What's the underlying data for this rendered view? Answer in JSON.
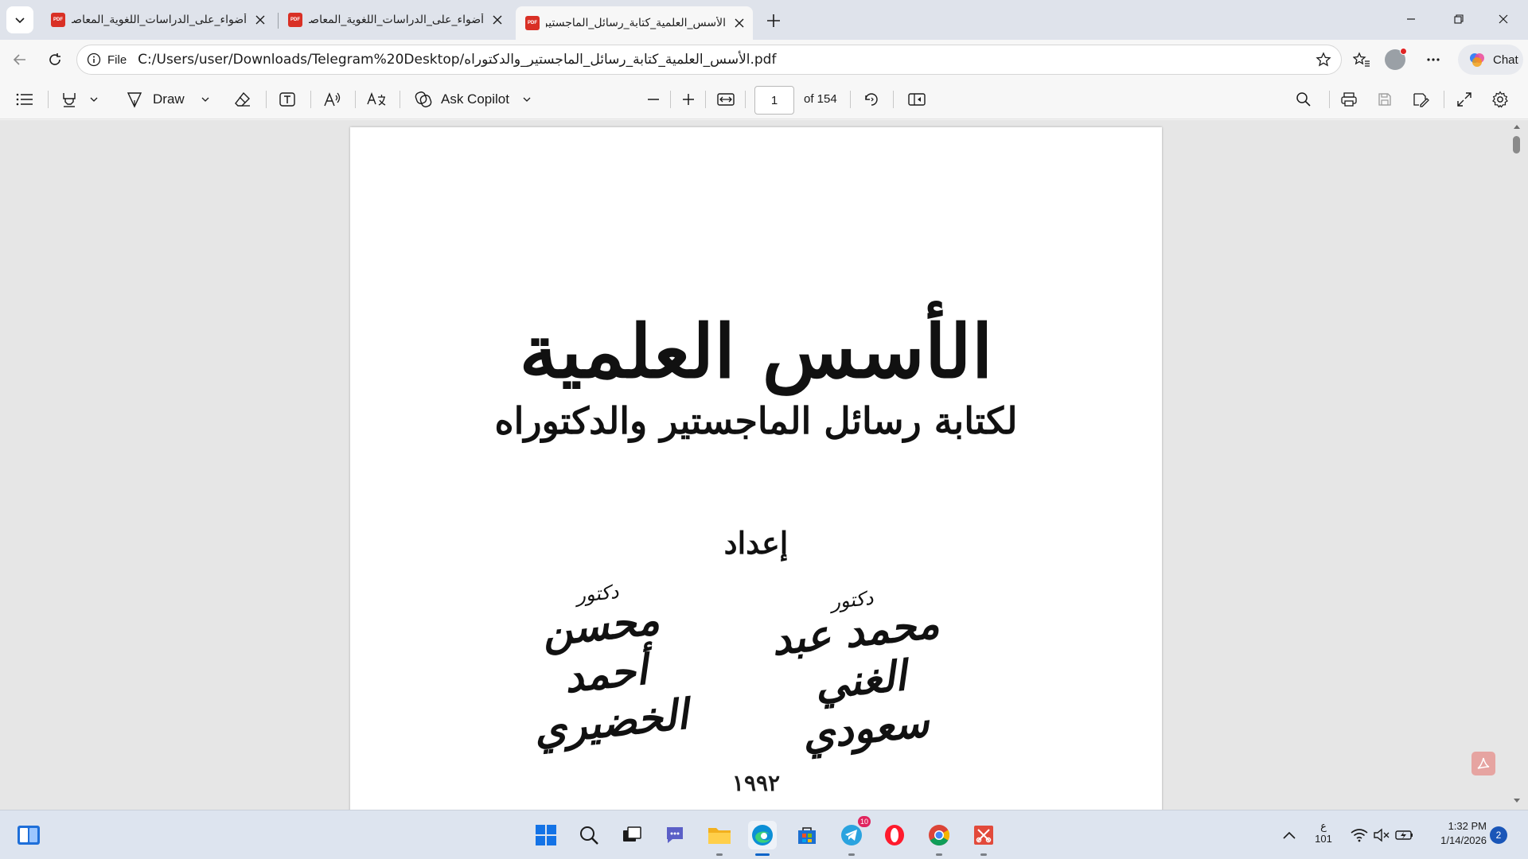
{
  "browser": {
    "tabs": [
      {
        "title": "أضواء_على_الدراسات_اللغوية_المعاصرة",
        "active": false
      },
      {
        "title": "أضواء_على_الدراسات_اللغوية_المعاصرة",
        "active": false
      },
      {
        "title": "الأسس_العلمية_كتابة_رسائل_الماجستير",
        "active": true
      }
    ],
    "pdf_badge": "PDF",
    "address": {
      "site_label": "File",
      "url": "C:/Users/user/Downloads/Telegram%20Desktop/الأسس_العلمية_كتابة_رسائل_الماجستير_والدكتوراه.pdf"
    },
    "chat_label": "Chat"
  },
  "pdf_toolbar": {
    "draw_label": "Draw",
    "copilot_label": "Ask Copilot",
    "page_current": "1",
    "page_total": "of 154"
  },
  "document": {
    "title": "الأسس العلمية",
    "subtitle": "لكتابة رسائل الماجستير والدكتوراه",
    "prepared_by": "إعداد",
    "authors": [
      {
        "degree": "دكتور",
        "name": "محمد عبد الغني سعودي"
      },
      {
        "degree": "دكتور",
        "name": "محسن أحمد الخضيري"
      }
    ],
    "year": "١٩٩٢"
  },
  "taskbar": {
    "telegram_badge": "10",
    "lang_top": "ع",
    "lang_bottom": "101",
    "time": "1:32 PM",
    "date": "1/14/2026",
    "notifications": "2"
  },
  "colors": {
    "accent": "#0a64c8",
    "pdf_red": "#d93025",
    "tabstrip": "#dfe3eb"
  }
}
